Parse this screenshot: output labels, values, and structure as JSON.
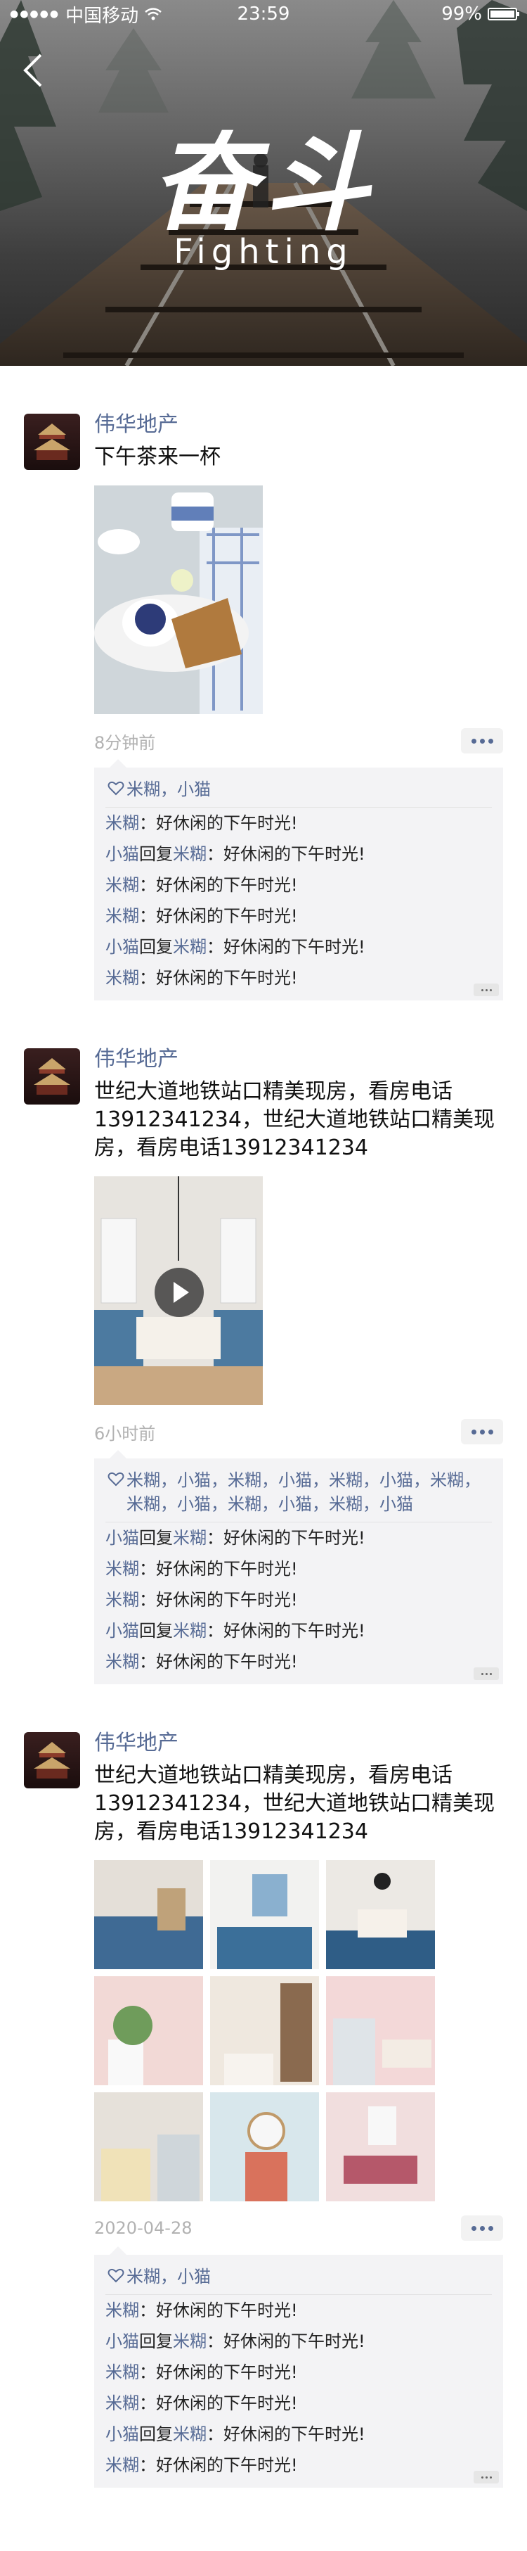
{
  "status_bar": {
    "carrier": "中国移动",
    "time": "23:59",
    "battery": "99%",
    "battery_level": 0.99
  },
  "banner": {
    "title": "奋斗",
    "subtitle": "Fighting"
  },
  "posts": [
    {
      "author": "伟华地产",
      "text": "下午茶来一杯",
      "time": "8分钟前",
      "likes": "米糊，小猫",
      "comments": [
        {
          "name": "米糊",
          "reply_word": "",
          "reply_to": "",
          "text": "：好休闲的下午时光!"
        },
        {
          "name": "小猫",
          "reply_word": "回复",
          "reply_to": "米糊",
          "text": "：好休闲的下午时光!"
        },
        {
          "name": "米糊",
          "reply_word": "",
          "reply_to": "",
          "text": "：好休闲的下午时光!"
        },
        {
          "name": "米糊",
          "reply_word": "",
          "reply_to": "",
          "text": "：好休闲的下午时光!"
        },
        {
          "name": "小猫",
          "reply_word": "回复",
          "reply_to": "米糊",
          "text": "：好休闲的下午时光!"
        },
        {
          "name": "米糊",
          "reply_word": "",
          "reply_to": "",
          "text": "：好休闲的下午时光!"
        }
      ]
    },
    {
      "author": "伟华地产",
      "text": "世纪大道地铁站口精美现房，看房电话13912341234，世纪大道地铁站口精美现房，看房电话13912341234",
      "time": "6小时前",
      "likes": "米糊，小猫，米糊，小猫，米糊，小猫，米糊，米糊，小猫，米糊，小猫，米糊，小猫",
      "comments": [
        {
          "name": "小猫",
          "reply_word": "回复",
          "reply_to": "米糊",
          "text": "：好休闲的下午时光!"
        },
        {
          "name": "米糊",
          "reply_word": "",
          "reply_to": "",
          "text": "：好休闲的下午时光!"
        },
        {
          "name": "米糊",
          "reply_word": "",
          "reply_to": "",
          "text": "：好休闲的下午时光!"
        },
        {
          "name": "小猫",
          "reply_word": "回复",
          "reply_to": "米糊",
          "text": "：好休闲的下午时光!"
        },
        {
          "name": "米糊",
          "reply_word": "",
          "reply_to": "",
          "text": "：好休闲的下午时光!"
        }
      ]
    },
    {
      "author": "伟华地产",
      "text": "世纪大道地铁站口精美现房，看房电话13912341234，世纪大道地铁站口精美现房，看房电话13912341234",
      "time": "2020-04-28",
      "likes": "米糊，小猫",
      "comments": [
        {
          "name": "米糊",
          "reply_word": "",
          "reply_to": "",
          "text": "：好休闲的下午时光!"
        },
        {
          "name": "小猫",
          "reply_word": "回复",
          "reply_to": "米糊",
          "text": "：好休闲的下午时光!"
        },
        {
          "name": "米糊",
          "reply_word": "",
          "reply_to": "",
          "text": "：好休闲的下午时光!"
        },
        {
          "name": "米糊",
          "reply_word": "",
          "reply_to": "",
          "text": "：好休闲的下午时光!"
        },
        {
          "name": "小猫",
          "reply_word": "回复",
          "reply_to": "米糊",
          "text": "：好休闲的下午时光!"
        },
        {
          "name": "米糊",
          "reply_word": "",
          "reply_to": "",
          "text": "：好休闲的下午时光!"
        }
      ]
    }
  ],
  "colors": {
    "link": "#576b95",
    "muted": "#b2b2b2",
    "comment_bg": "#f3f3f5"
  },
  "icons": [
    "signal-dots-icon",
    "wifi-icon",
    "battery-icon",
    "back-chevron-icon",
    "play-icon",
    "heart-icon",
    "more-dots-icon"
  ]
}
